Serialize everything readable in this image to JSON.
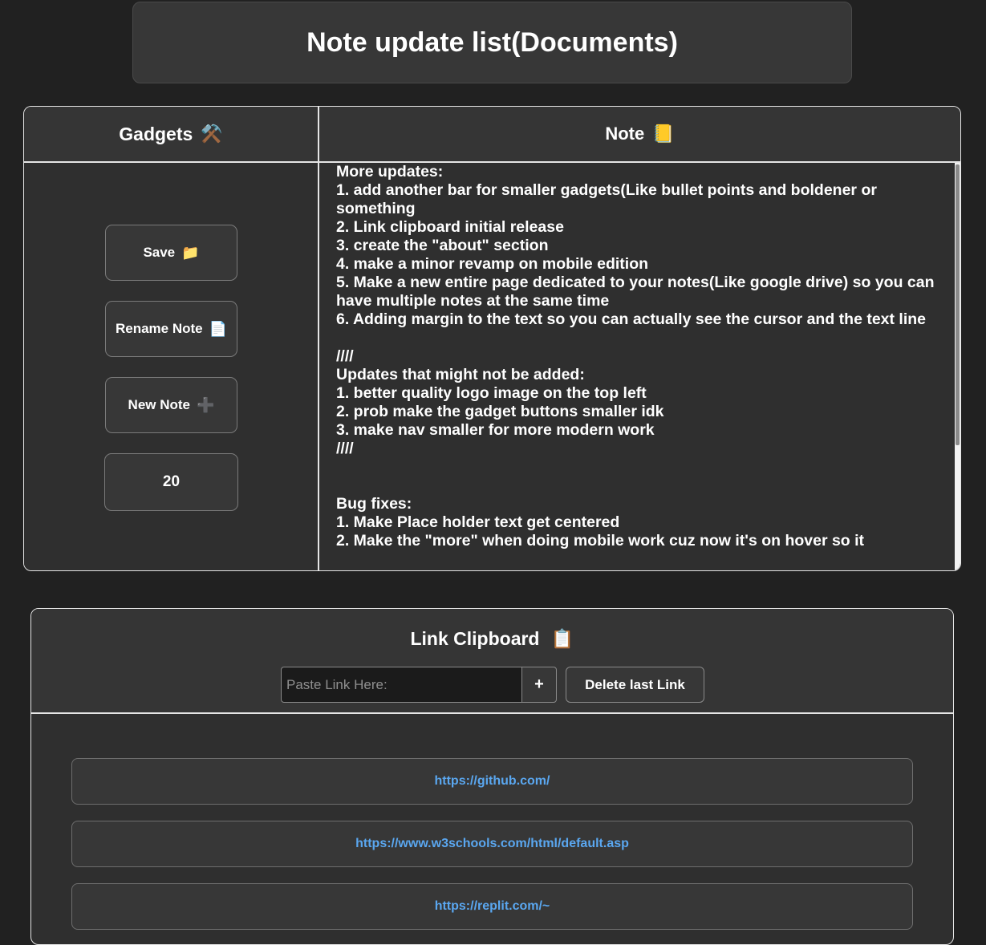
{
  "header": {
    "title": "Note update list(Documents)"
  },
  "editor": {
    "gadgets_title": "Gadgets",
    "gadgets_icon": "⚒️",
    "note_title": "Note",
    "note_icon": "📒",
    "buttons": {
      "save_label": "Save",
      "save_icon": "📁",
      "rename_label": "Rename Note",
      "rename_icon": "📄",
      "new_label": "New Note",
      "new_icon": "➕"
    },
    "counter_value": "20",
    "note_content": "More updates:\n1. add another bar for smaller gadgets(Like bullet points and boldener or something\n2. Link clipboard initial release\n3. create the \"about\" section\n4. make a minor revamp on mobile edition\n5. Make a new entire page dedicated to your notes(Like google drive) so you can have multiple notes at the same time\n6. Adding margin to the text so you can actually see the cursor and the text line\n\n////\nUpdates that might not be added:\n1. better quality logo image on the top left\n2. prob make the gadget buttons smaller idk\n3. make nav smaller for more modern work\n////\n\n\nBug fixes:\n1. Make Place holder text get centered\n2. Make the \"more\" when doing mobile work cuz now it's on hover so it"
  },
  "clipboard": {
    "title": "Link Clipboard",
    "icon": "📋",
    "input_placeholder": "Paste Link Here:",
    "add_label": "+",
    "delete_label": "Delete last Link",
    "links": [
      "https://github.com/",
      "https://www.w3schools.com/html/default.asp",
      "https://replit.com/~"
    ]
  },
  "colors": {
    "background": "#212121",
    "panel": "#373737",
    "link": "#5aa7f0",
    "accent_plus": "#8e6fd8"
  }
}
